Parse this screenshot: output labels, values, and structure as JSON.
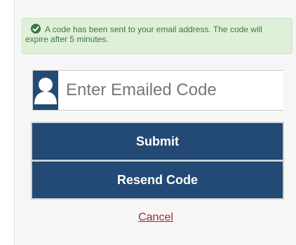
{
  "alert": {
    "icon": "check-circle-icon",
    "message": "A code has been sent to your email address. The code will expire after 5 minutes."
  },
  "code_field": {
    "icon": "user-icon",
    "placeholder": "Enter Emailed Code",
    "value": ""
  },
  "buttons": {
    "submit_label": "Submit",
    "resend_label": "Resend Code"
  },
  "cancel_link": "Cancel",
  "colors": {
    "brand_navy": "#234a75",
    "alert_bg": "#dff0d8",
    "alert_text": "#3c763d",
    "cancel_red": "#b22222"
  }
}
